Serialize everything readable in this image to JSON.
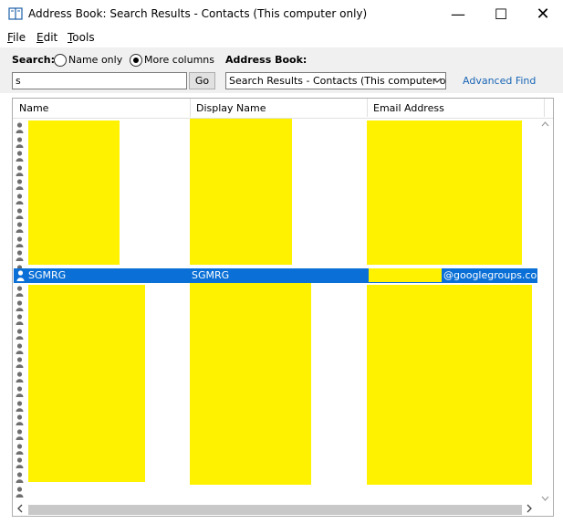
{
  "window": {
    "title": "Address Book: Search Results - Contacts (This computer only)",
    "min_glyph": "—",
    "max_glyph": "☐",
    "close_glyph": "✕"
  },
  "menu": [
    {
      "label": "File",
      "underline_index": 0
    },
    {
      "label": "Edit",
      "underline_index": 0
    },
    {
      "label": "Tools",
      "underline_index": 0
    }
  ],
  "search": {
    "label": "Search:",
    "option_name_only": "Name only",
    "option_more_columns": "More columns",
    "selected": "more_columns",
    "query": "s",
    "go_label": "Go"
  },
  "address_book": {
    "label": "Address Book:",
    "selected": "Search Results - Contacts (This computer o",
    "advanced_find": "Advanced Find"
  },
  "columns": [
    "Name",
    "Display Name",
    "Email Address"
  ],
  "selected_row": {
    "name": "SGMRG",
    "display_name": "SGMRG",
    "email_suffix": "@googlegroups.com"
  },
  "icons": {
    "contact": "contact-person-icon",
    "app": "address-book-icon"
  },
  "colors": {
    "selection": "#0a6fd6",
    "redaction": "#fff200",
    "link": "#1a66b5"
  }
}
